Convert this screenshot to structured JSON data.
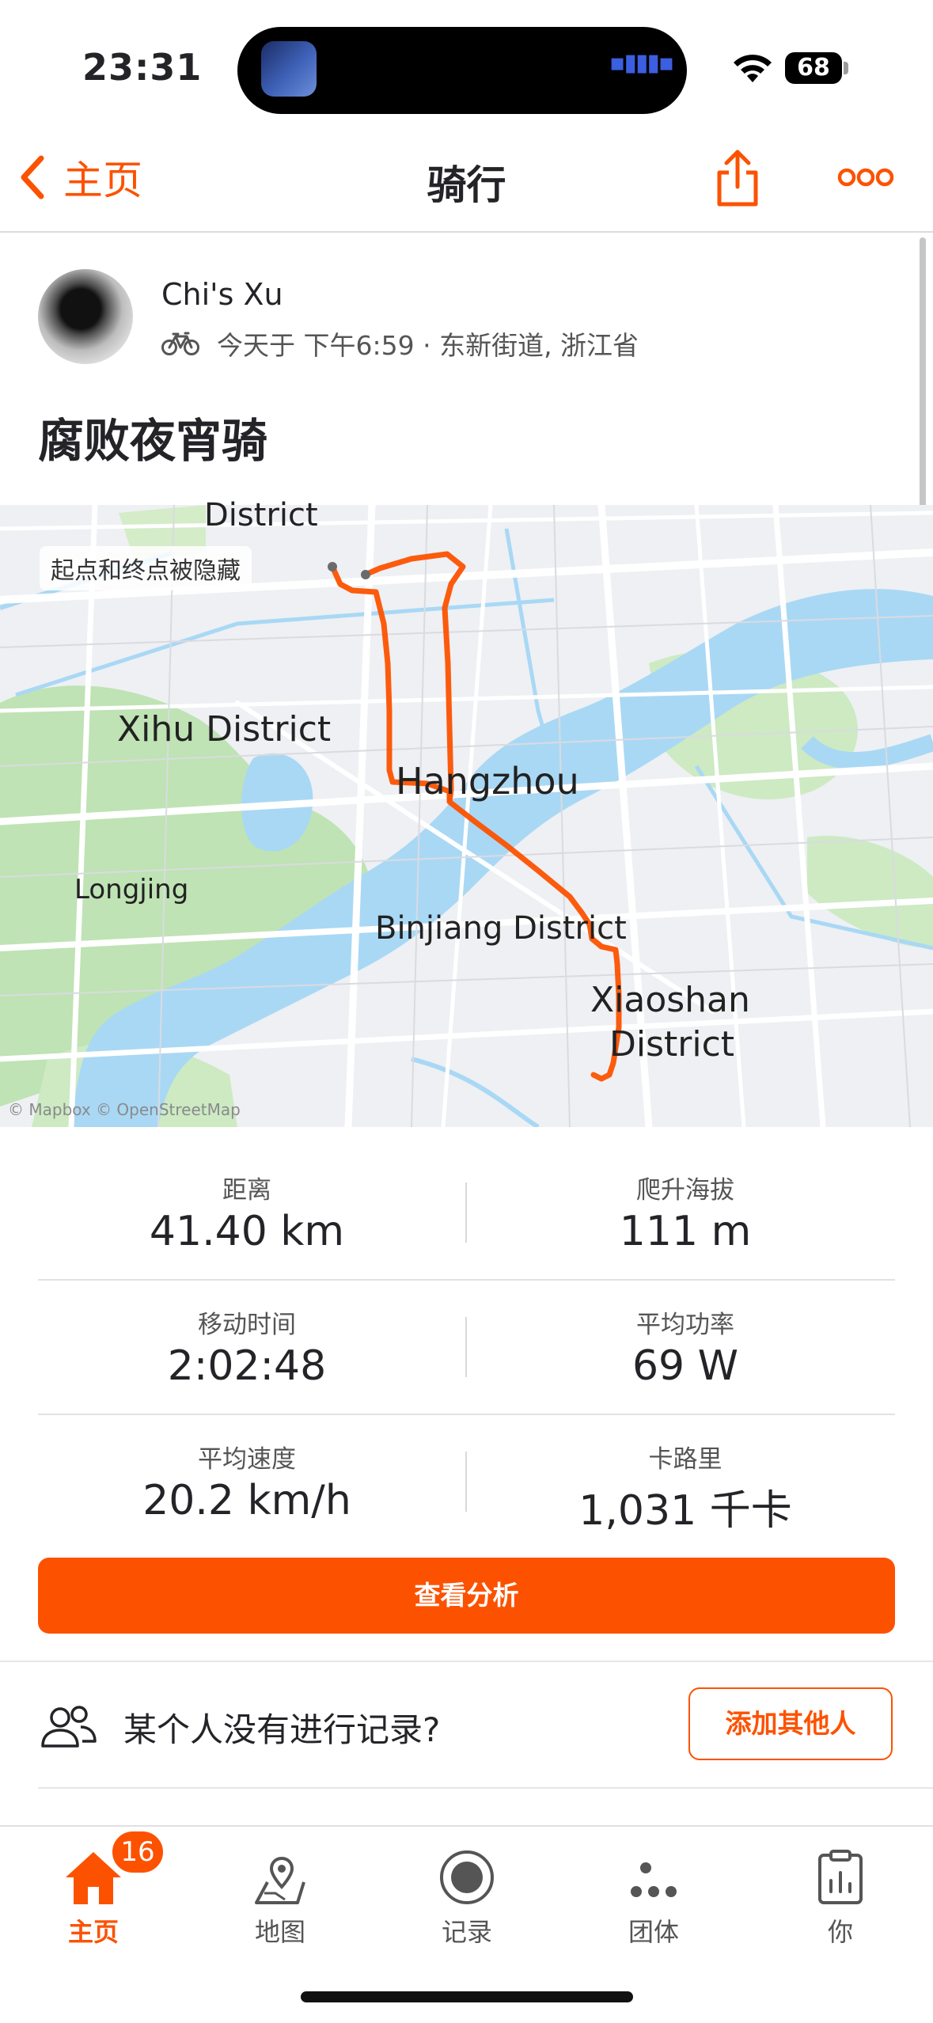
{
  "status_bar": {
    "time": "23:31",
    "battery": "68"
  },
  "nav": {
    "back_label": "主页",
    "title": "骑行"
  },
  "activity": {
    "athlete_name": "Chi's Xu",
    "meta": "今天于 下午6:59 · 东新街道, 浙江省",
    "title": "腐败夜宵骑"
  },
  "map": {
    "privacy_note": "起点和终点被隐藏",
    "labels": {
      "district_top": "District",
      "xihu": "Xihu District",
      "hangzhou": "Hangzhou",
      "longjing": "Longjing",
      "binjiang": "Binjiang District",
      "xiaoshan_1": "Xiaoshan",
      "xiaoshan_2": "District",
      "attribution": "© Mapbox © OpenStreetMap"
    },
    "route_color": "#fc5200"
  },
  "stats": [
    {
      "label": "距离",
      "value": "41.40 km"
    },
    {
      "label": "爬升海拔",
      "value": "111 m"
    },
    {
      "label": "移动时间",
      "value": "2:02:48"
    },
    {
      "label": "平均功率",
      "value": "69 W"
    },
    {
      "label": "平均速度",
      "value": "20.2 km/h"
    },
    {
      "label": "卡路里",
      "value": "1,031 千卡"
    }
  ],
  "actions": {
    "analyze_label": "查看分析",
    "missing_people_text": "某个人没有进行记录?",
    "add_others_label": "添加其他人"
  },
  "tabbar": {
    "badge": "16",
    "tabs": [
      {
        "label": "主页",
        "icon": "home-icon"
      },
      {
        "label": "地图",
        "icon": "map-icon"
      },
      {
        "label": "记录",
        "icon": "record-icon"
      },
      {
        "label": "团体",
        "icon": "groups-icon"
      },
      {
        "label": "你",
        "icon": "clipboard-icon"
      }
    ]
  },
  "colors": {
    "accent": "#fc5200",
    "water": "#a9d8f5",
    "park": "#bfe3b4"
  }
}
